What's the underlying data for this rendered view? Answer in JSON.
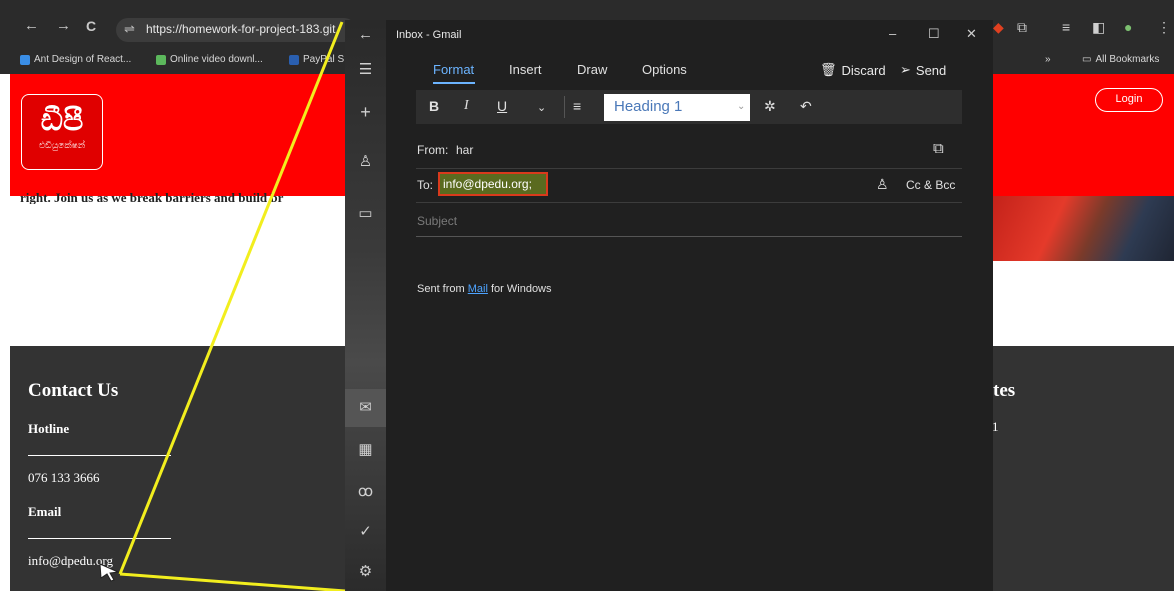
{
  "browser": {
    "back": "←",
    "forward": "→",
    "reload": "C",
    "url": "https://homework-for-project-183.git",
    "bookmarks": [
      "Ant Design of React...",
      "Online video downl...",
      "PayPal S"
    ],
    "more": "»",
    "all_bookmarks": "All Bookmarks"
  },
  "site": {
    "logo_text": "ඩීපී",
    "logo_sub": "එඩියුකේෂන්",
    "login": "Login",
    "hero_text": "right. Join us as we break barriers and build br",
    "contact_title": "Contact Us",
    "hotline_label": "Hotline",
    "hotline_value": "076 133 3666",
    "email_label": "Email",
    "email_value": "info@dpedu.org",
    "right_title_fragment": "tes",
    "right_digit": "1"
  },
  "mail": {
    "window_title": "Inbox - Gmail",
    "tabs": [
      "Format",
      "Insert",
      "Draw",
      "Options"
    ],
    "discard": "Discard",
    "send": "Send",
    "toolbar": {
      "bold": "B",
      "italic": "I",
      "underline": "U",
      "style": "Heading 1"
    },
    "from_label": "From:",
    "from_value": "har",
    "to_label": "To:",
    "to_value": "info@dpedu.org;",
    "cc_bcc": "Cc & Bcc",
    "subject_placeholder": "Subject",
    "body_prefix": "Sent from",
    "body_link": "Mail",
    "body_suffix": "for Windows"
  },
  "colors": {
    "header_red": "#ff0000",
    "footer_gray": "#333333",
    "accent_blue": "#6cb4ff",
    "highlight_box": "#d93a1c",
    "annotation_yellow": "#f2ee1e"
  }
}
